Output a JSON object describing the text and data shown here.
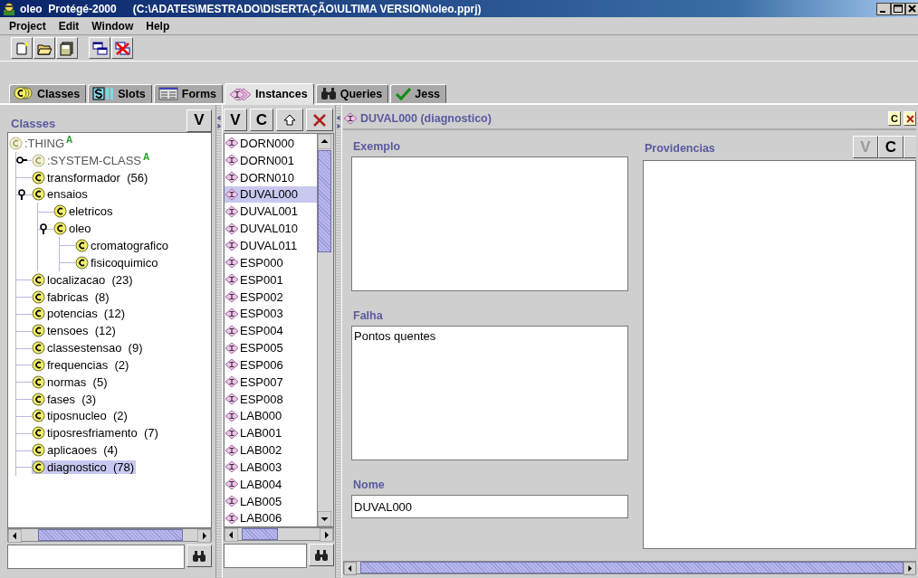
{
  "window": {
    "title": "oleo  Protégé-2000",
    "path": "(C:\\ADATES\\MESTRADO\\DISERTAÇÃO\\ULTIMA VERSION\\oleo.pprj)"
  },
  "menu": [
    "Project",
    "Edit",
    "Window",
    "Help"
  ],
  "tabs": [
    {
      "label": "Classes",
      "kind": "classes",
      "selected": false
    },
    {
      "label": "Slots",
      "kind": "slots",
      "selected": false
    },
    {
      "label": "Forms",
      "kind": "forms",
      "selected": false
    },
    {
      "label": "Instances",
      "kind": "instances",
      "selected": true
    },
    {
      "label": "Queries",
      "kind": "queries",
      "selected": false
    },
    {
      "label": "Jess",
      "kind": "jess",
      "selected": false
    }
  ],
  "classes_panel": {
    "title": "Classes",
    "buttons": [
      "V"
    ],
    "tree": [
      {
        "label": ":THING",
        "abstract": true,
        "marker": "A",
        "selected": false,
        "children": [
          {
            "label": ":SYSTEM-CLASS",
            "abstract": true,
            "marker": "A",
            "selected": false,
            "expanded": false
          },
          {
            "label": "transformador  (56)",
            "abstract": false,
            "selected": false
          },
          {
            "label": "ensaios",
            "abstract": false,
            "selected": false,
            "expanded": true,
            "children": [
              {
                "label": "eletricos",
                "abstract": false,
                "selected": false
              },
              {
                "label": "oleo",
                "abstract": false,
                "selected": false,
                "expanded": true,
                "children": [
                  {
                    "label": "cromatografico",
                    "abstract": false,
                    "selected": false
                  },
                  {
                    "label": "fisicoquimico",
                    "abstract": false,
                    "selected": false
                  }
                ]
              }
            ]
          },
          {
            "label": "localizacao  (23)",
            "abstract": false,
            "selected": false
          },
          {
            "label": "fabricas  (8)",
            "abstract": false,
            "selected": false
          },
          {
            "label": "potencias  (12)",
            "abstract": false,
            "selected": false
          },
          {
            "label": "tensoes  (12)",
            "abstract": false,
            "selected": false
          },
          {
            "label": "classestensao  (9)",
            "abstract": false,
            "selected": false
          },
          {
            "label": "frequencias  (2)",
            "abstract": false,
            "selected": false
          },
          {
            "label": "normas  (5)",
            "abstract": false,
            "selected": false
          },
          {
            "label": "fases  (3)",
            "abstract": false,
            "selected": false
          },
          {
            "label": "tiposnucleo  (2)",
            "abstract": false,
            "selected": false
          },
          {
            "label": "tiposresfriamento  (7)",
            "abstract": false,
            "selected": false
          },
          {
            "label": "aplicaoes  (4)",
            "abstract": false,
            "selected": false
          },
          {
            "label": "diagnostico  (78)",
            "abstract": false,
            "selected": true
          }
        ]
      }
    ]
  },
  "instances_panel": {
    "buttons": [
      "V",
      "C"
    ],
    "items": [
      {
        "label": "DORN000",
        "selected": false
      },
      {
        "label": "DORN001",
        "selected": false
      },
      {
        "label": "DORN010",
        "selected": false
      },
      {
        "label": "DUVAL000",
        "selected": true
      },
      {
        "label": "DUVAL001",
        "selected": false
      },
      {
        "label": "DUVAL010",
        "selected": false
      },
      {
        "label": "DUVAL011",
        "selected": false
      },
      {
        "label": "ESP000",
        "selected": false
      },
      {
        "label": "ESP001",
        "selected": false
      },
      {
        "label": "ESP002",
        "selected": false
      },
      {
        "label": "ESP003",
        "selected": false
      },
      {
        "label": "ESP004",
        "selected": false
      },
      {
        "label": "ESP005",
        "selected": false
      },
      {
        "label": "ESP006",
        "selected": false
      },
      {
        "label": "ESP007",
        "selected": false
      },
      {
        "label": "ESP008",
        "selected": false
      },
      {
        "label": "LAB000",
        "selected": false
      },
      {
        "label": "LAB001",
        "selected": false
      },
      {
        "label": "LAB002",
        "selected": false
      },
      {
        "label": "LAB003",
        "selected": false
      },
      {
        "label": "LAB004",
        "selected": false
      },
      {
        "label": "LAB005",
        "selected": false
      },
      {
        "label": "LAB006",
        "selected": false
      }
    ]
  },
  "form": {
    "title": "DUVAL000 (diagnostico)",
    "buttons": [
      "C"
    ],
    "left_fields": [
      {
        "label": "Exemplo",
        "kind": "list"
      },
      {
        "label": "Falha",
        "kind": "textarea",
        "value": "Pontos quentes"
      },
      {
        "label": "Nome",
        "kind": "text",
        "value": "DUVAL000"
      }
    ],
    "right_field": {
      "label": "Providencias",
      "kind": "list",
      "buttons": [
        "V",
        "C"
      ]
    }
  }
}
